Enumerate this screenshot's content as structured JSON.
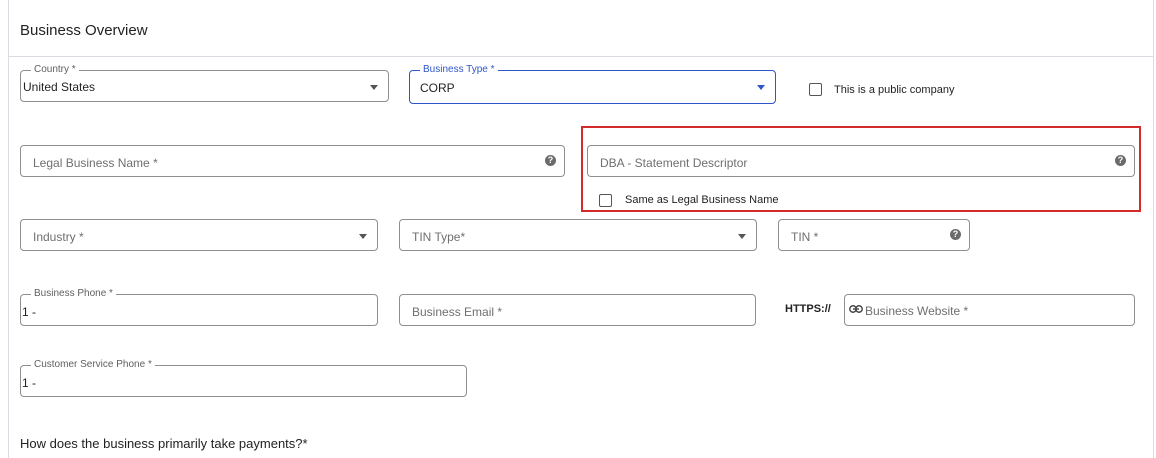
{
  "header": {
    "title": "Business Overview"
  },
  "country": {
    "label": "Country *",
    "value": "United States"
  },
  "business_type": {
    "label": "Business Type *",
    "value": "CORP"
  },
  "public_company": {
    "label": "This is a public company",
    "checked": false
  },
  "legal_name": {
    "placeholder": "Legal Business Name *"
  },
  "dba": {
    "placeholder": "DBA - Statement Descriptor"
  },
  "same_as_legal": {
    "label": "Same as Legal Business Name",
    "checked": false
  },
  "industry": {
    "placeholder": "Industry *"
  },
  "tin_type": {
    "placeholder": "TIN Type*"
  },
  "tin": {
    "placeholder": "TIN *"
  },
  "business_phone": {
    "label": "Business Phone *",
    "value": "1 -"
  },
  "business_email": {
    "placeholder": "Business Email *"
  },
  "website": {
    "prefix": "HTTPS://",
    "placeholder": "Business Website *"
  },
  "customer_service_phone": {
    "label": "Customer Service Phone *",
    "value": "1 -"
  },
  "payments_question": "How does the business primarily take payments?*",
  "colors": {
    "focus_blue": "#2f55c9",
    "highlight_red": "#d42a2a",
    "border_gray": "#8f8f8f"
  }
}
